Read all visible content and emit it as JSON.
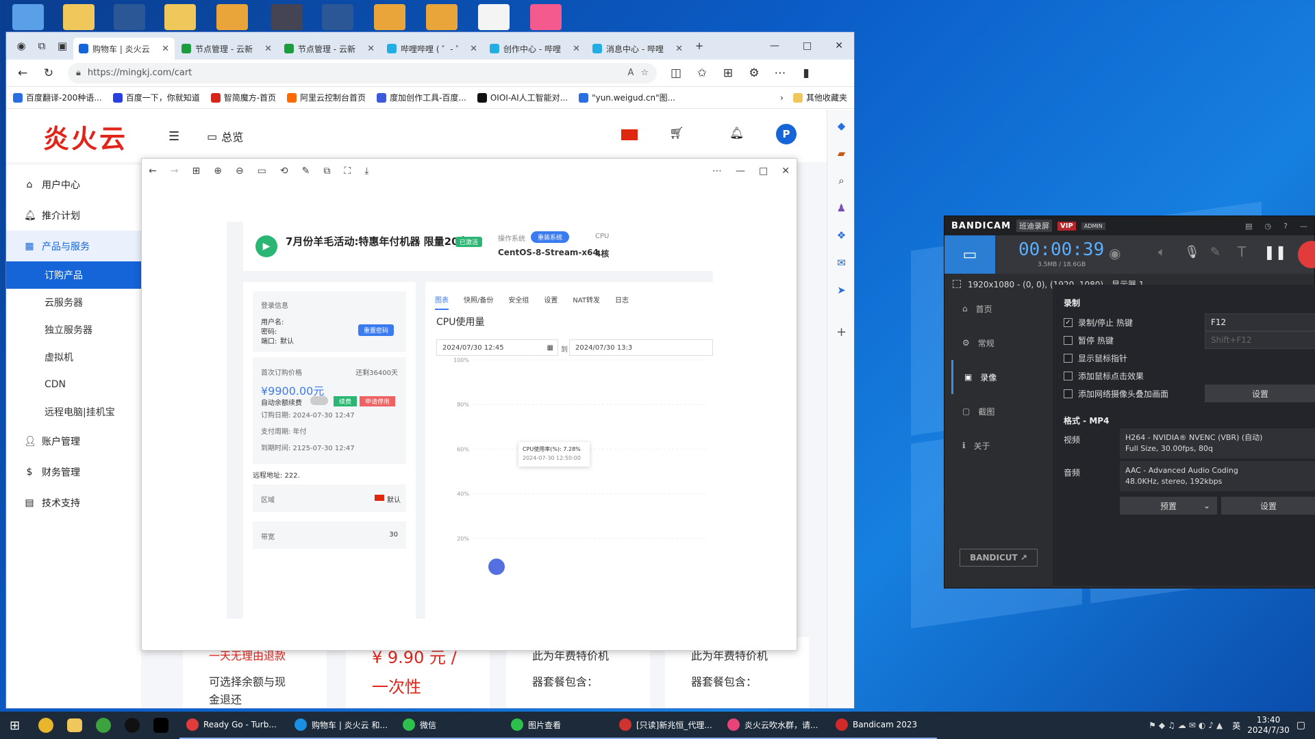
{
  "browser": {
    "tabs": [
      {
        "label": "购物车 | 炎火云",
        "active": true,
        "color": "#1565d8"
      },
      {
        "label": "节点管理 - 云新",
        "active": false,
        "color": "#1b9d3e"
      },
      {
        "label": "节点管理 - 云新",
        "active": false,
        "color": "#1b9d3e"
      },
      {
        "label": "哔哩哔哩 ( ゜- ゜",
        "active": false,
        "color": "#23ade5"
      },
      {
        "label": "创作中心 - 哔哩",
        "active": false,
        "color": "#23ade5"
      },
      {
        "label": "消息中心 - 哔哩",
        "active": false,
        "color": "#23ade5"
      }
    ],
    "url": "https://mingkj.com/cart",
    "bookmarks": [
      {
        "label": "百度翻译-200种语...",
        "color": "#2a6fe0"
      },
      {
        "label": "百度一下，你就知道",
        "color": "#2a3fe0"
      },
      {
        "label": "智简魔方-首页",
        "color": "#d6261c"
      },
      {
        "label": "阿里云控制台首页",
        "color": "#ff6a00"
      },
      {
        "label": "度加创作工具-百度...",
        "color": "#3b5bdb"
      },
      {
        "label": "OIOI-AI人工智能对...",
        "color": "#111111"
      },
      {
        "label": "\"yun.weigud.cn\"图...",
        "color": "#2a6fe0"
      }
    ],
    "bookmark_more": "其他收藏夹"
  },
  "site": {
    "logo": "炎火云",
    "overview": "总览",
    "avatar_letter": "P",
    "sidebar": [
      {
        "label": "用户中心",
        "type": "item",
        "icon": "home-icon"
      },
      {
        "label": "推介计划",
        "type": "item",
        "icon": "bell-icon"
      },
      {
        "label": "产品与服务",
        "type": "open",
        "icon": "grid-icon"
      },
      {
        "label": "订购产品",
        "type": "active"
      },
      {
        "label": "云服务器",
        "type": "sub"
      },
      {
        "label": "独立服务器",
        "type": "sub"
      },
      {
        "label": "虚拟机",
        "type": "sub"
      },
      {
        "label": "CDN",
        "type": "sub"
      },
      {
        "label": "远程电脑|挂机宝",
        "type": "sub"
      },
      {
        "label": "账户管理",
        "type": "item",
        "icon": "user-icon"
      },
      {
        "label": "财务管理",
        "type": "item",
        "icon": "money-icon"
      },
      {
        "label": "技术支持",
        "type": "item",
        "icon": "doc-icon"
      }
    ],
    "cards": [
      {
        "l1": "一天无理由退款",
        "l2": "可选择余额与现",
        "l3": "金退还"
      },
      {
        "price": "¥ 9.90 元 /",
        "unit": "一次性"
      },
      {
        "l1": "此为年费特价机",
        "l2": "器套餐包含："
      },
      {
        "l1": "此为年费特价机",
        "l2": "器套餐包含："
      }
    ]
  },
  "viewer": {
    "product_title": "7月份羊毛活动:特惠年付机器 限量20台!",
    "status_badge": "已激活",
    "os_label": "操作系统",
    "os_button": "重装系统",
    "os_name": "CentOS-8-Stream-x64",
    "cpu_label": "CPU",
    "cpu_value": "4核",
    "login_info": "登录信息",
    "username_label": "用户名:",
    "password_label": "密码:",
    "port_label": "端口:",
    "port_value": "默认",
    "reset_password": "重置密码",
    "first_price_label": "首次订购价格",
    "remaining": "还剩36400天",
    "price": "¥9900.00元",
    "auto_renew": "自动余额续费",
    "renew_btn": "续费",
    "refund_btn": "申请停用",
    "order_date": "订购日期: 2024-07-30 12:47",
    "pay_cycle": "支付周期: 年付",
    "expire": "到期时间: 2125-07-30 12:47",
    "remote_addr": "远程地址: 222.",
    "region_label": "区域",
    "region_value": "默认",
    "bandwidth_label": "带宽",
    "bandwidth_value": "30",
    "tabs": [
      "图表",
      "快照/备份",
      "安全组",
      "设置",
      "NAT转发",
      "日志"
    ],
    "chart_title": "CPU使用量",
    "date_from": "2024/07/30 12:45",
    "date_sep": "到",
    "date_to": "2024/07/30 13:3",
    "tooltip_title": "CPU使用率(%): 7.28%",
    "tooltip_time": "2024-07-30 12:50:00"
  },
  "chart_data": {
    "type": "line",
    "title": "CPU使用量",
    "yticks": [
      "100%",
      "80%",
      "60%",
      "40%",
      "20%"
    ],
    "ylim": [
      0,
      100
    ],
    "series": [
      {
        "x": [
          "2024-07-30 12:50:00"
        ],
        "values": [
          7.28
        ]
      }
    ]
  },
  "bandicam": {
    "brand": "BANDICAM",
    "sub": "班迪录屏",
    "vip": "VIP",
    "admin": "ADMIN",
    "timer": "00:00:39",
    "size": "3.5MB / 18.6GB",
    "region": "1920x1080 - (0, 0), (1920, 1080) - 显示器 1",
    "nav": [
      "首页",
      "常规",
      "录像",
      "截图",
      "关于"
    ],
    "record_title": "录制",
    "options": [
      {
        "label": "录制/停止 热键",
        "checked": true
      },
      {
        "label": "暂停 热键",
        "checked": false
      },
      {
        "label": "显示鼠标指针",
        "checked": false
      },
      {
        "label": "添加鼠标点击效果",
        "checked": false
      },
      {
        "label": "添加网络摄像头叠加画面",
        "checked": false
      }
    ],
    "hotkey1": "F12",
    "hotkey2": "Shift+F12",
    "settings": "设置",
    "format_title": "格式 - MP4",
    "video_label": "视频",
    "video_l1": "H264 - NVIDIA® NVENC (VBR) (自动)",
    "video_l2": "Full Size, 30.00fps, 80q",
    "audio_label": "音频",
    "audio_l1": "AAC - Advanced Audio Coding",
    "audio_l2": "48.0KHz, stereo, 192kbps",
    "bandicut": "BANDICUT ↗",
    "preset": "预置",
    "settings2": "设置"
  },
  "taskbar": {
    "apps": [
      {
        "label": "Ready Go - Turb...",
        "color": "#e23b3b"
      },
      {
        "label": "购物车 | 炎火云 和...",
        "color": "#1a8fe3"
      },
      {
        "label": "微信",
        "color": "#2ec04d"
      },
      {
        "label": "图片查看",
        "color": "#2ec04d"
      },
      {
        "label": "[只读]新兆恒_代理...",
        "color": "#d0332e"
      },
      {
        "label": "炎火云吹水群，请...",
        "color": "#e8447a"
      },
      {
        "label": "Bandicam 2023",
        "color": "#d12a2a"
      }
    ],
    "ime": "英",
    "time": "13:40",
    "date": "2024/7/30"
  }
}
